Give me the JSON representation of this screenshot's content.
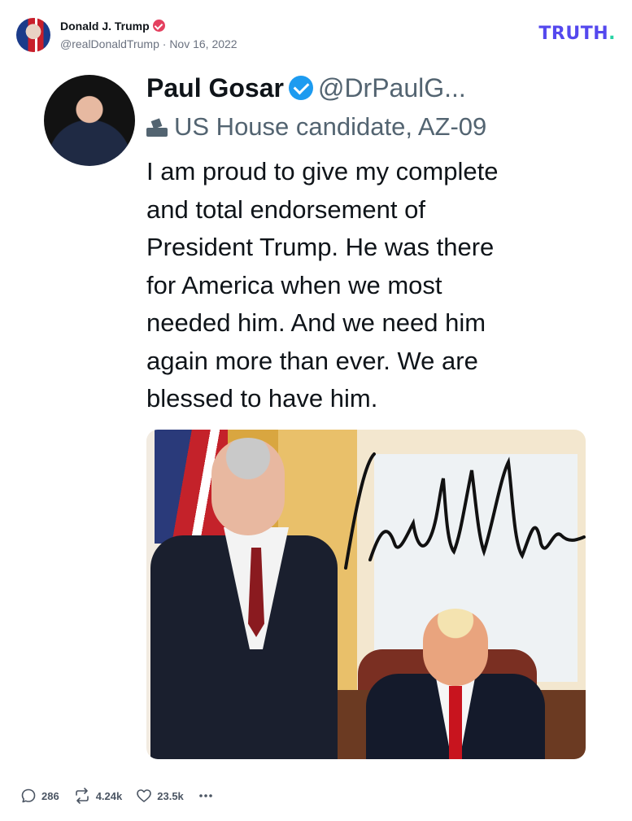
{
  "post": {
    "author_name": "Donald J. Trump",
    "author_handle": "@realDonaldTrump",
    "separator": "·",
    "date": "Nov 16, 2022",
    "logo_text": "TRUTH",
    "logo_dot": "."
  },
  "embedded_tweet": {
    "name": "Paul Gosar",
    "handle": "@DrPaulG...",
    "label": "US House candidate, AZ-09",
    "text_lines": [
      "I am proud to give my complete",
      "and total endorsement of",
      "President Trump.  He was there",
      "for America when we most",
      "needed him.  And we need him",
      "again more than ever. We are",
      "blessed to have him."
    ]
  },
  "actions": {
    "replies": "286",
    "retruths": "4.24k",
    "likes": "23.5k"
  },
  "colors": {
    "truth_brand": "#5448ee",
    "truth_dot": "#28d3a4",
    "verified_pink": "#e4405f",
    "twitter_blue": "#1d9bf0"
  },
  "icons": [
    "verified-badge-icon",
    "ballot-box-icon",
    "reply-icon",
    "retruth-icon",
    "like-icon",
    "more-icon"
  ]
}
